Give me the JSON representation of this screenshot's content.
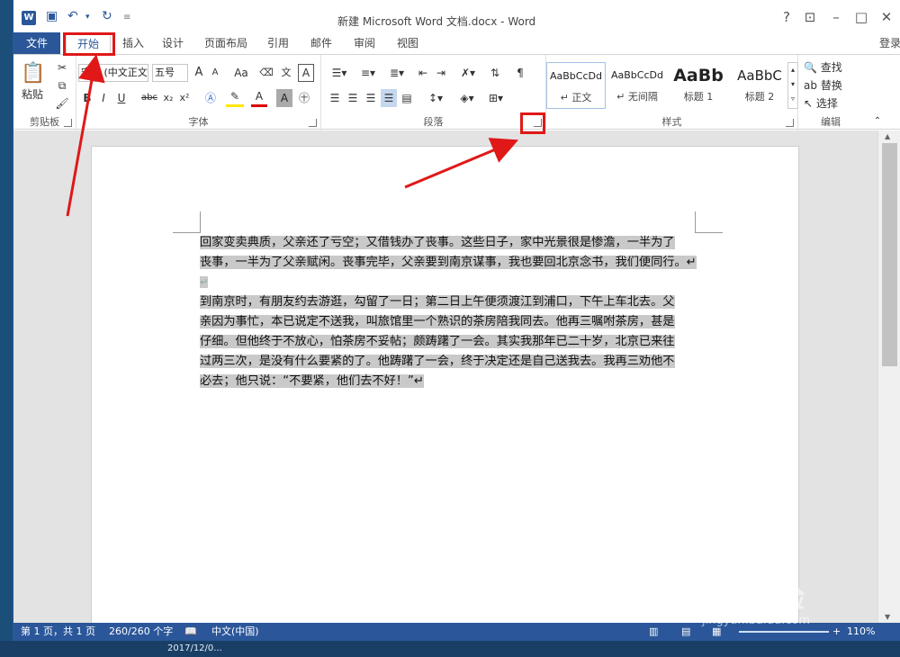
{
  "window": {
    "title": "新建 Microsoft Word 文档.docx - Word",
    "help": "?",
    "login": "登录"
  },
  "tabs": [
    "文件",
    "开始",
    "插入",
    "设计",
    "页面布局",
    "引用",
    "邮件",
    "审阅",
    "视图"
  ],
  "ribbon": {
    "clipboard": {
      "label": "剪贴板",
      "paste": "粘贴"
    },
    "font": {
      "label": "字体",
      "font_name": "宋体 (中文正文)",
      "font_size": "五号",
      "bold": "B",
      "italic": "I",
      "underline": "U",
      "strike": "abc",
      "sub": "x₂",
      "sup": "x²",
      "aa": "Aa",
      "grow": "A",
      "shrink": "A"
    },
    "paragraph": {
      "label": "段落"
    },
    "styles": {
      "label": "样式",
      "items": [
        {
          "sample": "AaBbCcDd",
          "name": "↵ 正文"
        },
        {
          "sample": "AaBbCcDd",
          "name": "↵ 无间隔"
        },
        {
          "sample": "AaBb",
          "name": "标题 1"
        },
        {
          "sample": "AaBbC",
          "name": "标题 2"
        }
      ]
    },
    "editing": {
      "label": "编辑",
      "find": "查找",
      "replace": "替换",
      "select": "选择"
    }
  },
  "document": {
    "lines": [
      "回家变卖典质，父亲还了亏空；又借钱办了丧事。这些日子，家中光景很是惨澹，一半为了",
      "丧事，一半为了父亲赋闲。丧事完毕，父亲要到南京谋事，我也要回北京念书，我们便同行。↵",
      "↵",
      "到南京时，有朋友约去游逛，勾留了一日；第二日上午便须渡江到浦口，下午上车北去。父",
      "亲因为事忙，本已说定不送我，叫旅馆里一个熟识的茶房陪我同去。他再三嘱咐茶房，甚是",
      "仔细。但他终于不放心，怕茶房不妥帖；颇踌躇了一会。其实我那年已二十岁，北京已来往",
      "过两三次，是没有什么要紧的了。他踌躇了一会，终于决定还是自己送我去。我再三劝他不",
      "必去；他只说：“不要紧，他们去不好！”↵"
    ]
  },
  "status": {
    "page": "第 1 页，共 1 页",
    "words": "260/260 个字",
    "lang": "中文(中国)",
    "zoom": "110%"
  },
  "taskbar": {
    "clock": "2017/12/0..."
  },
  "watermark": {
    "brand": "Bai 经验",
    "url": "jingyan.baidu.com"
  }
}
